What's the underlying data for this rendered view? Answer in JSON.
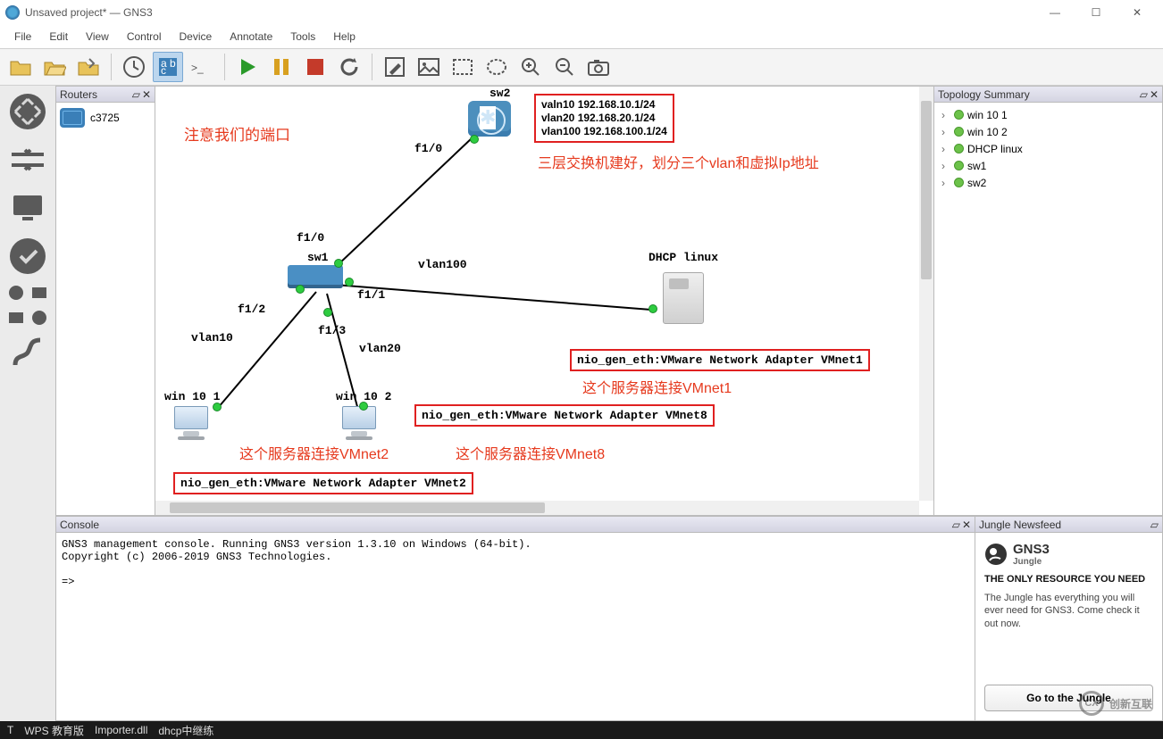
{
  "window": {
    "title": "Unsaved project* — GNS3"
  },
  "menu": [
    "File",
    "Edit",
    "View",
    "Control",
    "Device",
    "Annotate",
    "Tools",
    "Help"
  ],
  "panels": {
    "routers": "Routers",
    "topo": "Topology Summary",
    "console": "Console",
    "jungle": "Jungle Newsfeed"
  },
  "routers": [
    {
      "name": "c3725"
    }
  ],
  "topo_items": [
    "win 10 1",
    "win 10 2",
    "DHCP linux",
    "sw1",
    "sw2"
  ],
  "console_text": "GNS3 management console. Running GNS3 version 1.3.10 on Windows (64-bit).\nCopyright (c) 2006-2019 GNS3 Technologies.\n\n=> ",
  "jungle": {
    "brand": "GNS3",
    "sub": "Jungle",
    "headline": "THE ONLY RESOURCE YOU NEED",
    "text": "The Jungle has everything you will ever need for GNS3. Come check it out now.",
    "button": "Go to the Jungle"
  },
  "annotations": {
    "port_note": "注意我们的端口",
    "l3_note": "三层交换机建好，划分三个vlan和虚拟Ip地址",
    "vmnet1_note": "这个服务器连接VMnet1",
    "vmnet2_note": "这个服务器连接VMnet2",
    "vmnet8_note": "这个服务器连接VMnet8"
  },
  "vlan_box": {
    "l1": "valn10 192.168.10.1/24",
    "l2": "vlan20 192.168.20.1/24",
    "l3": "vlan100 192.168.100.1/24"
  },
  "nio": {
    "v1": "nio_gen_eth:VMware Network Adapter VMnet1",
    "v2": "nio_gen_eth:VMware Network Adapter VMnet2",
    "v8": "nio_gen_eth:VMware Network Adapter VMnet8"
  },
  "labels": {
    "sw1": "sw1",
    "sw2": "sw2",
    "dhcp": "DHCP linux",
    "w1": "win 10 1",
    "w2": "win 10 2",
    "f10_top": "f1/0",
    "f10_bot": "f1/0",
    "f11": "f1/1",
    "f12": "f1/2",
    "f13": "f1/3",
    "vlan10": "vlan10",
    "vlan20": "vlan20",
    "vlan100": "vlan100"
  },
  "taskbar": {
    "a": "T",
    "b": "WPS 教育版",
    "c": "Importer.dll",
    "d": "dhcp中继练"
  },
  "watermark": "创新互联"
}
